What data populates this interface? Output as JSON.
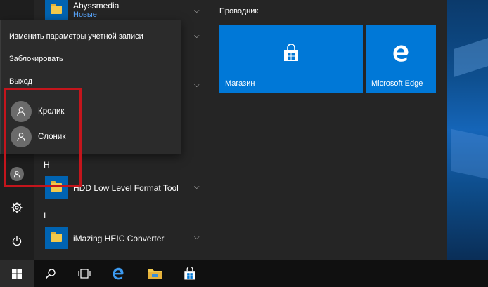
{
  "start_menu": {
    "apps": [
      {
        "name": "Abyssmedia",
        "sub": "Новые"
      },
      {
        "letter": "H"
      },
      {
        "name": "HDD Low Level Format Tool"
      },
      {
        "letter": "I"
      },
      {
        "name": "iMazing HEIC Converter"
      }
    ],
    "tile_group": "Проводник",
    "tiles": [
      {
        "label": "Магазин",
        "icon": "store-icon"
      },
      {
        "label": "Microsoft Edge",
        "icon": "edge-icon"
      }
    ]
  },
  "account_menu": {
    "items": [
      "Изменить параметры учетной записи",
      "Заблокировать",
      "Выход"
    ],
    "users": [
      {
        "name": "Кролик",
        "icon": "user-icon"
      },
      {
        "name": "Слоник",
        "icon": "user-icon"
      }
    ]
  },
  "rail": {
    "icons": [
      "settings-icon",
      "power-icon"
    ]
  },
  "taskbar": {
    "icons": [
      "windows-start-icon",
      "search-icon",
      "task-view-icon",
      "edge-icon",
      "file-explorer-icon",
      "store-icon"
    ]
  },
  "colors": {
    "accent": "#0078d7",
    "highlight_border": "#c4151c",
    "new_label": "#59a7ff"
  }
}
